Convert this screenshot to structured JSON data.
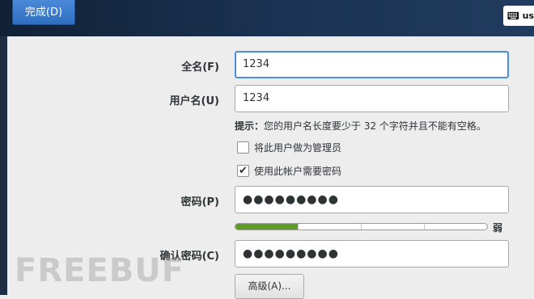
{
  "header": {
    "done_label": "完成(D)",
    "keyboard_layout": "us",
    "keyboard_icon": "keyboard-icon"
  },
  "form": {
    "fullname_label": "全名(F)",
    "fullname_value": "1234",
    "username_label": "用户名(U)",
    "username_value": "1234",
    "hint_bold": "提示：",
    "hint_text": "您的用户名长度要少于 32 个字符并且不能有空格。",
    "admin_checkbox_label": "将此用户做为管理员",
    "admin_checked": false,
    "require_password_label": "使用此帐户需要密码",
    "require_password_checked": true,
    "password_label": "密码(P)",
    "password_value": "●●●●●●●●●",
    "strength_text": "弱",
    "strength_level": 0.25,
    "confirm_label": "确认密码(C)",
    "confirm_value": "●●●●●●●●●",
    "advanced_label": "高级(A)..."
  },
  "watermark": "FREEBUF",
  "colors": {
    "accent": "#4a90d9",
    "strength_fill": "#5f9c26",
    "topbar": "#1b3454"
  }
}
